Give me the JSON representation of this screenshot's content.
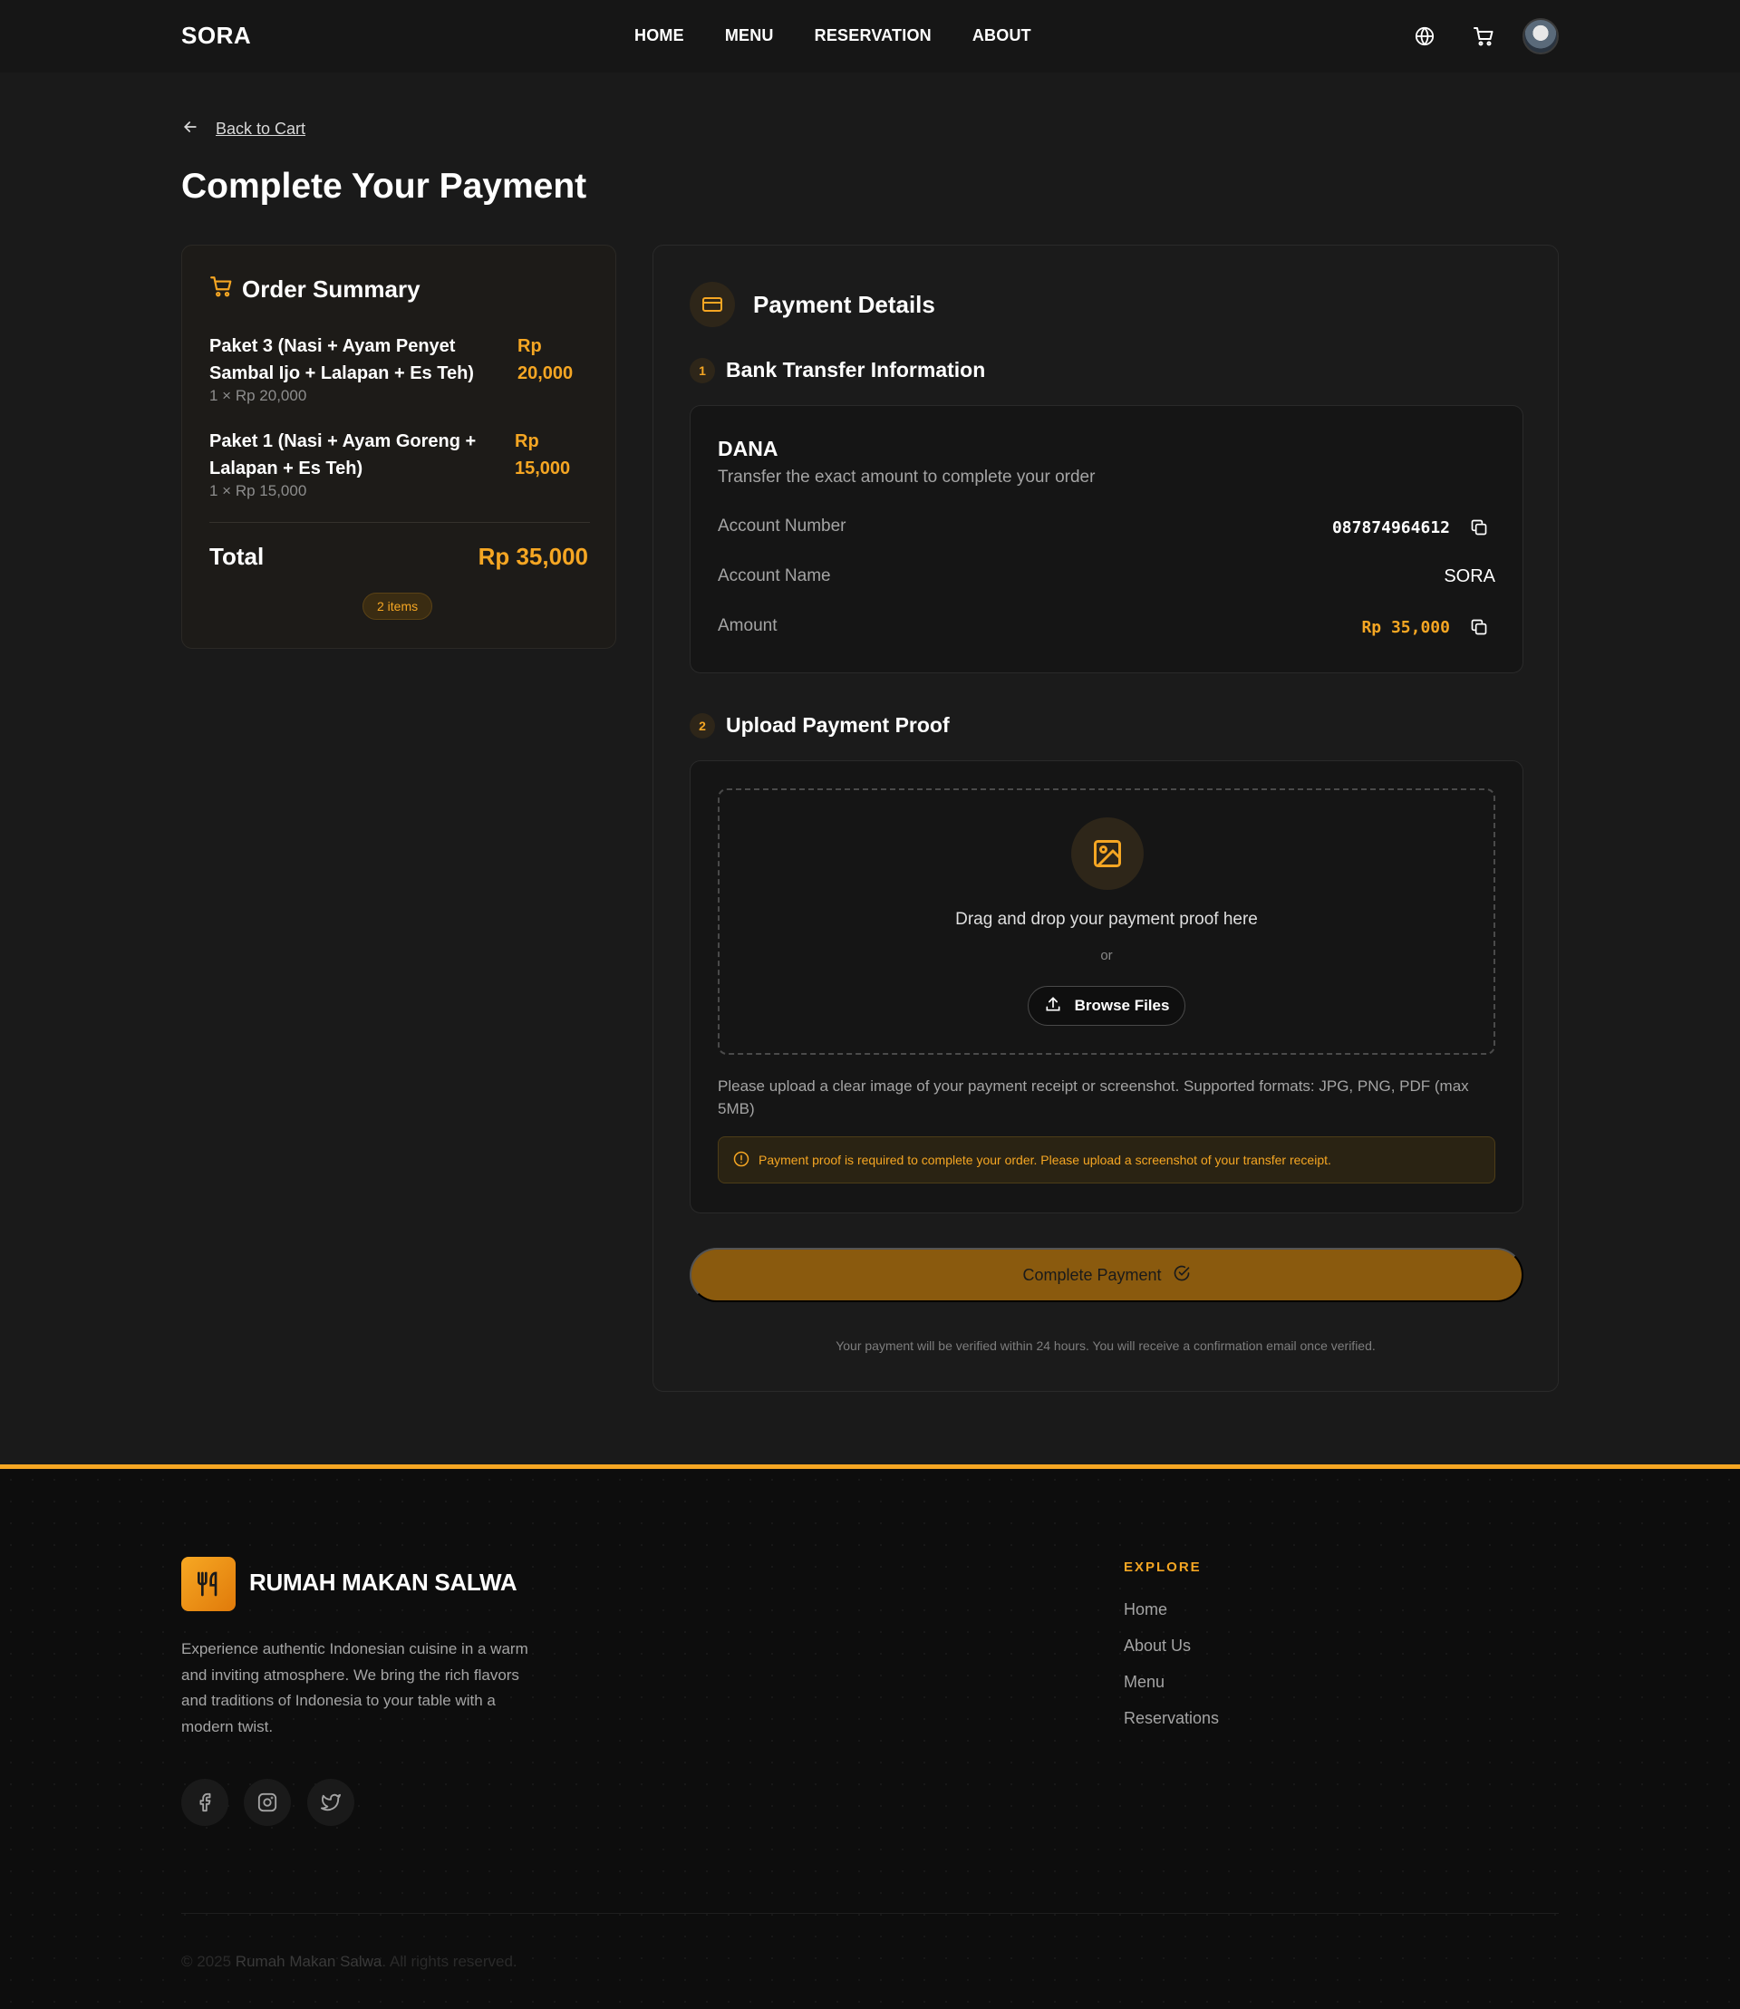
{
  "header": {
    "brand": "SORA",
    "nav": [
      "HOME",
      "MENU",
      "RESERVATION",
      "ABOUT"
    ],
    "icons": [
      "globe-icon",
      "cart-icon"
    ]
  },
  "back_link": "Back to Cart",
  "page_title": "Complete Your Payment",
  "order_summary": {
    "title": "Order Summary",
    "items": [
      {
        "name": "Paket 3 (Nasi + Ayam Penyet Sambal Ijo + Lalapan + Es Teh)",
        "price_lines": [
          "Rp",
          "20,000"
        ],
        "qty": "1 × Rp 20,000"
      },
      {
        "name": "Paket 1 (Nasi + Ayam Goreng + Lalapan + Es Teh)",
        "price_lines": [
          "Rp",
          "15,000"
        ],
        "qty": "1 × Rp 15,000"
      }
    ],
    "total_label": "Total",
    "total_value": "Rp 35,000",
    "items_badge": "2 items"
  },
  "payment": {
    "title": "Payment Details",
    "step1": {
      "num": "1",
      "title": "Bank Transfer Information"
    },
    "bank": {
      "name": "DANA",
      "subtitle": "Transfer the exact amount to complete your order",
      "account_number_label": "Account Number",
      "account_number": "087874964612",
      "account_name_label": "Account Name",
      "account_name": "SORA",
      "amount_label": "Amount",
      "amount": "Rp 35,000"
    },
    "step2": {
      "num": "2",
      "title": "Upload Payment Proof"
    },
    "upload": {
      "drop_text": "Drag and drop your payment proof here",
      "or": "or",
      "browse": "Browse Files",
      "hint": "Please upload a clear image of your payment receipt or screenshot. Supported formats: JPG, PNG, PDF (max 5MB)",
      "alert": "Payment proof is required to complete your order. Please upload a screenshot of your transfer receipt."
    },
    "complete_button": "Complete Payment",
    "verify_note": "Your payment will be verified within 24 hours. You will receive a confirmation email once verified."
  },
  "footer": {
    "name": "RUMAH MAKAN SALWA",
    "description": "Experience authentic Indonesian cuisine in a warm and inviting atmosphere. We bring the rich flavors and traditions of Indonesia to your table with a modern twist.",
    "social": [
      "facebook-icon",
      "instagram-icon",
      "twitter-icon"
    ],
    "explore_heading": "EXPLORE",
    "links": [
      "Home",
      "About Us",
      "Menu",
      "Reservations"
    ],
    "copyright_prefix": "© 2025 ",
    "copyright_name": "Rumah Makan Salwa",
    "copyright_suffix": ". All rights reserved."
  },
  "colors": {
    "accent": "#f5a623",
    "button": "#8a5a0e",
    "background": "#1a1a1a"
  }
}
